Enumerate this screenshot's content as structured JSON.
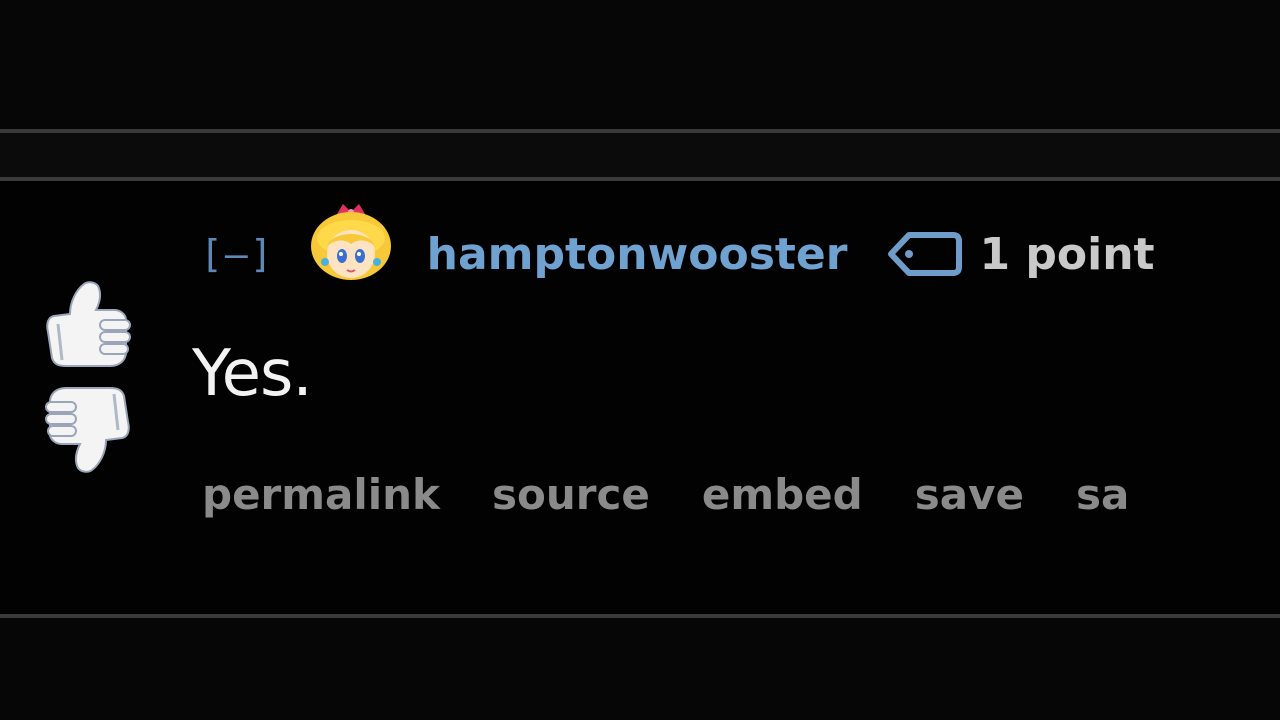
{
  "tagline": {
    "collapse_label": "[–]",
    "author": "hamptonwooster",
    "score": "1 point"
  },
  "comment": {
    "body": "Yes."
  },
  "buttons": [
    "permalink",
    "source",
    "embed",
    "save",
    "sa"
  ],
  "colors": {
    "background": "#050505",
    "author": "#6fa2d0",
    "collapse": "#5d88b8",
    "button": "#8a8a8a",
    "body_text": "#f2f2f2"
  },
  "icons": {
    "upvote": "thumbs-up-icon",
    "downvote": "thumbs-down-icon",
    "flair": "princess-peach-avatar",
    "tag": "tag-icon"
  }
}
